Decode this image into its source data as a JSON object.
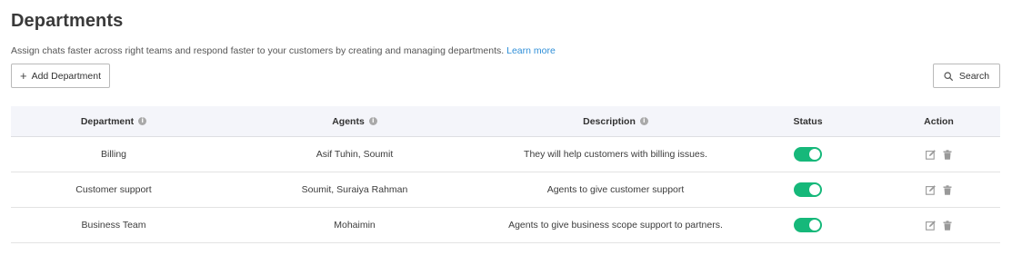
{
  "page": {
    "title": "Departments",
    "subtitle": "Assign chats faster across right teams and respond faster to your customers by creating and managing departments.",
    "learn_more": "Learn more"
  },
  "toolbar": {
    "add_label": "Add Department",
    "search_label": "Search"
  },
  "table": {
    "headers": {
      "department": "Department",
      "agents": "Agents",
      "description": "Description",
      "status": "Status",
      "action": "Action"
    },
    "rows": [
      {
        "department": "Billing",
        "agents": "Asif Tuhin, Soumit",
        "description": "They will help customers with billing issues.",
        "status": "on"
      },
      {
        "department": "Customer support",
        "agents": "Soumit, Suraiya Rahman",
        "description": "Agents to give customer support",
        "status": "on"
      },
      {
        "department": "Business Team",
        "agents": "Mohaimin",
        "description": "Agents to give business scope support to partners.",
        "status": "on"
      }
    ]
  },
  "colors": {
    "accent_link": "#2f8fd8",
    "toggle_on": "#16b87a",
    "header_bg": "#f4f5fa"
  },
  "icons": {
    "add": "plus-icon",
    "search": "search-icon",
    "info": "info-icon",
    "edit": "edit-icon",
    "delete": "trash-icon"
  }
}
